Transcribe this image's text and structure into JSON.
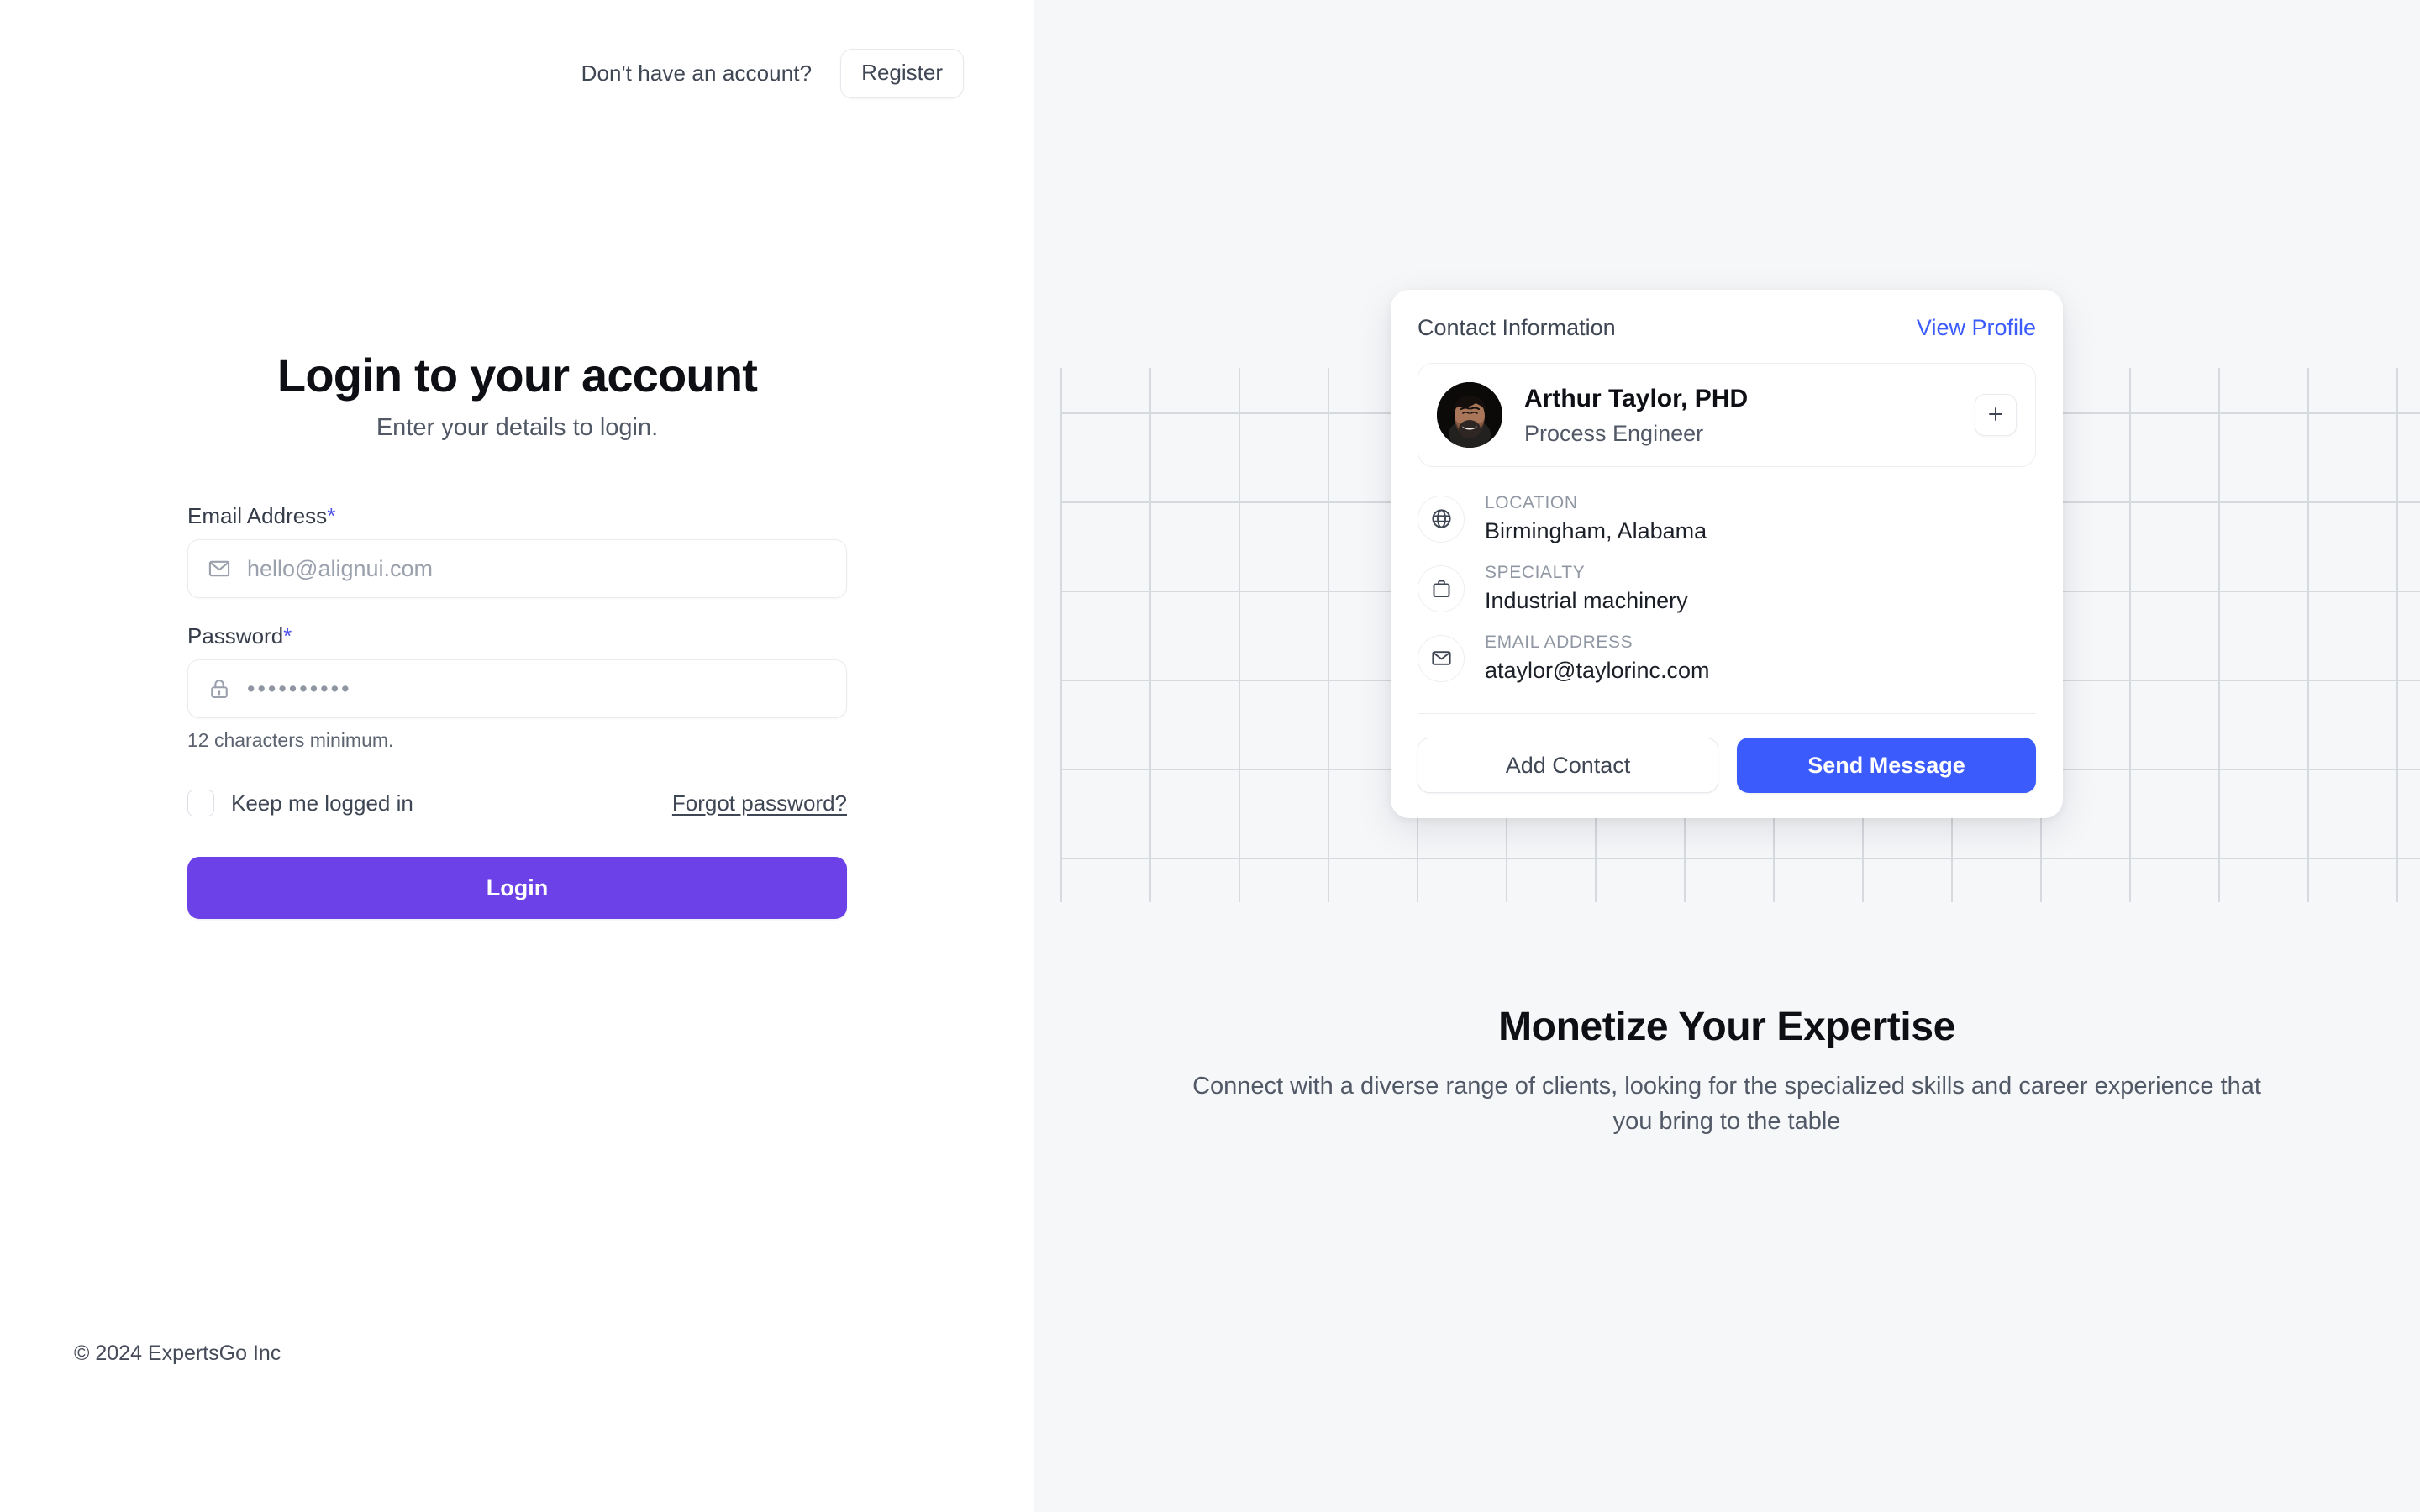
{
  "header": {
    "prompt": "Don't have an account?",
    "register_label": "Register"
  },
  "login": {
    "title": "Login to your account",
    "subtitle": "Enter your details to login.",
    "email": {
      "label": "Email Address",
      "required_mark": "*",
      "placeholder": "hello@alignui.com",
      "value": "",
      "icon": "envelope-icon"
    },
    "password": {
      "label": "Password",
      "required_mark": "*",
      "value": "••••••••••",
      "helper": "12 characters minimum.",
      "icon": "lock-icon"
    },
    "keep_logged_in_label": "Keep me logged in",
    "keep_logged_in_checked": false,
    "forgot_password_label": "Forgot password?",
    "submit_label": "Login"
  },
  "footer": {
    "copyright": "© 2024 ExpertsGo Inc"
  },
  "contact_card": {
    "header_title": "Contact Information",
    "view_profile_label": "View Profile",
    "person": {
      "name": "Arthur Taylor, PHD",
      "role": "Process Engineer",
      "add_icon": "plus-icon",
      "avatar": "avatar-photo"
    },
    "details": [
      {
        "label": "LOCATION",
        "value": "Birmingham, Alabama",
        "icon": "globe-icon"
      },
      {
        "label": "SPECIALTY",
        "value": "Industrial machinery",
        "icon": "briefcase-icon"
      },
      {
        "label": "EMAIL ADDRESS",
        "value": "ataylor@taylorinc.com",
        "icon": "envelope-icon"
      }
    ],
    "actions": {
      "add_contact_label": "Add Contact",
      "send_message_label": "Send Message"
    }
  },
  "promo": {
    "title": "Monetize Your Expertise",
    "subtitle": "Connect with a diverse range of clients, looking for the specialized skills and career experience that you bring to the table"
  },
  "colors": {
    "login_button": "#6d41e8",
    "send_message_button": "#3b5bfd",
    "link_blue": "#3b5bfd",
    "required_star": "#4f52e8",
    "right_panel_bg": "#f5f7f9",
    "grid_line": "#d6d9de"
  }
}
